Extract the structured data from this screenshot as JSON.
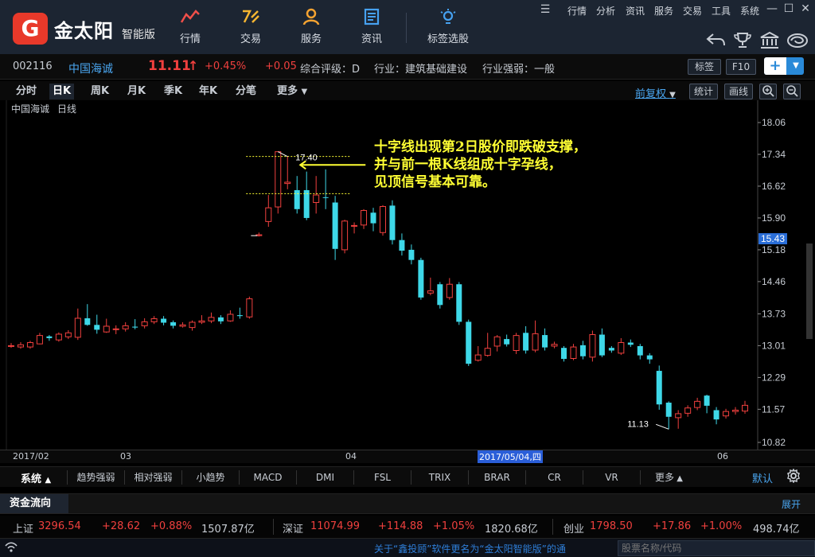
{
  "app": {
    "logo_char": "G",
    "brand": "金太阳",
    "brand_sub": "智能版"
  },
  "nav": [
    {
      "icon": "chart-line-icon",
      "glyph": "〽",
      "label": "行情",
      "color": "#f04f4a"
    },
    {
      "icon": "trade-icon",
      "glyph": "⚡",
      "label": "交易",
      "color": "#f5b531"
    },
    {
      "icon": "user-icon",
      "glyph": "👤",
      "label": "服务",
      "color": "#f5a331"
    },
    {
      "icon": "news-icon",
      "glyph": "☰",
      "label": "资讯",
      "color": "#46a1f0"
    },
    {
      "icon": "bulb-icon",
      "glyph": "💡",
      "label": "标签选股",
      "color": "#46a1f0"
    }
  ],
  "menu": [
    "行情",
    "分析",
    "资讯",
    "服务",
    "交易",
    "工具",
    "系统"
  ],
  "quote": {
    "code": "002116",
    "name": "中国海诚",
    "price": "11.11",
    "arrow": "↑",
    "pct": "+0.45%",
    "chg": "+0.05",
    "rating": "综合评级：D",
    "industry": "行业：建筑基础建设",
    "strength": "行业强弱：一般",
    "tag_btn": "标签",
    "f10_btn": "F10"
  },
  "periods": [
    "分时",
    "日K",
    "周K",
    "月K",
    "季K",
    "年K",
    "分笔",
    "更多"
  ],
  "active_period": "日K",
  "right_tools": {
    "adjust": "前复权",
    "stat": "统计",
    "draw": "画线"
  },
  "chart_title": {
    "name": "中国海诚",
    "period": "日线"
  },
  "annotation": {
    "line1": "十字线出现第2日股价即跌破支撑，",
    "line2": "并与前一根K线组成十字孕线，",
    "line3": "见顶信号基本可靠。",
    "high_label": "17.40",
    "low_label": "11.13",
    "color": "#ffff33"
  },
  "chart_data": {
    "type": "candlestick",
    "y_ticks": [
      18.06,
      17.34,
      16.62,
      15.9,
      15.18,
      14.46,
      13.73,
      13.01,
      12.29,
      11.57,
      10.82
    ],
    "current_price_label": "15.43",
    "ylim": [
      10.82,
      18.06
    ],
    "colors": {
      "up": "#f0403e",
      "down": "#3ed8e8"
    },
    "x_labels": [
      "2017/02",
      "03",
      "04",
      "2017/05/04,四",
      "06"
    ],
    "candles": [
      [
        13.01,
        13.01,
        13.07,
        12.96
      ],
      [
        12.98,
        13.03,
        13.09,
        12.94
      ],
      [
        12.98,
        13.08,
        13.12,
        12.94
      ],
      [
        13.05,
        13.24,
        13.3,
        13.04
      ],
      [
        13.22,
        13.18,
        13.25,
        13.12
      ],
      [
        13.14,
        13.27,
        13.31,
        13.1
      ],
      [
        13.21,
        13.3,
        13.36,
        13.16
      ],
      [
        13.2,
        13.63,
        13.85,
        13.14
      ],
      [
        13.63,
        13.48,
        13.95,
        13.46
      ],
      [
        13.48,
        13.37,
        13.71,
        13.28
      ],
      [
        13.32,
        13.45,
        13.62,
        13.3
      ],
      [
        13.38,
        13.39,
        13.47,
        13.27
      ],
      [
        13.39,
        13.46,
        13.54,
        13.33
      ],
      [
        13.44,
        13.42,
        13.61,
        13.38
      ],
      [
        13.46,
        13.55,
        13.63,
        13.4
      ],
      [
        13.55,
        13.62,
        13.68,
        13.5
      ],
      [
        13.62,
        13.53,
        13.68,
        13.47
      ],
      [
        13.54,
        13.46,
        13.58,
        13.4
      ],
      [
        13.45,
        13.48,
        13.54,
        13.42
      ],
      [
        13.42,
        13.54,
        13.58,
        13.35
      ],
      [
        13.54,
        13.57,
        13.7,
        13.5
      ],
      [
        13.57,
        13.65,
        13.76,
        13.52
      ],
      [
        13.65,
        13.56,
        13.7,
        13.5
      ],
      [
        13.57,
        13.72,
        13.81,
        13.55
      ],
      [
        13.7,
        13.68,
        13.87,
        13.62
      ],
      [
        13.66,
        14.07,
        14.12,
        13.62
      ],
      [
        15.5,
        15.52,
        15.57,
        15.48
      ],
      [
        15.82,
        16.13,
        16.42,
        15.7
      ],
      [
        16.15,
        17.4,
        17.4,
        16.0
      ],
      [
        16.68,
        16.71,
        17.3,
        16.55
      ],
      [
        16.53,
        16.1,
        16.85,
        16.0
      ],
      [
        16.53,
        15.9,
        16.95,
        15.85
      ],
      [
        16.25,
        16.42,
        16.85,
        16.0
      ],
      [
        16.37,
        16.36,
        17.0,
        16.1
      ],
      [
        16.25,
        15.2,
        16.4,
        14.95
      ],
      [
        15.18,
        15.83,
        15.86,
        15.1
      ],
      [
        15.73,
        15.73,
        15.8,
        15.55
      ],
      [
        15.74,
        16.07,
        16.1,
        15.65
      ],
      [
        16.02,
        15.78,
        16.13,
        15.6
      ],
      [
        15.57,
        16.16,
        16.19,
        15.5
      ],
      [
        16.18,
        15.4,
        16.3,
        15.3
      ],
      [
        15.4,
        15.16,
        15.55,
        15.05
      ],
      [
        15.18,
        14.95,
        15.3,
        14.85
      ],
      [
        14.95,
        14.1,
        15.0,
        14.05
      ],
      [
        14.2,
        14.25,
        14.55,
        14.15
      ],
      [
        14.4,
        13.93,
        14.45,
        13.85
      ],
      [
        14.1,
        14.4,
        14.54,
        14.05
      ],
      [
        14.4,
        13.55,
        14.45,
        13.48
      ],
      [
        13.55,
        12.6,
        13.6,
        12.55
      ],
      [
        12.68,
        12.8,
        13.0,
        12.65
      ],
      [
        12.79,
        12.95,
        13.3,
        12.76
      ],
      [
        13.0,
        13.21,
        13.25,
        12.88
      ],
      [
        13.16,
        13.04,
        13.26,
        12.99
      ],
      [
        12.9,
        13.24,
        13.3,
        12.82
      ],
      [
        13.3,
        12.9,
        13.45,
        12.83
      ],
      [
        12.91,
        13.28,
        13.58,
        12.86
      ],
      [
        13.25,
        12.97,
        13.4,
        12.9
      ],
      [
        13.0,
        13.04,
        13.1,
        12.95
      ],
      [
        12.96,
        12.71,
        13.0,
        12.65
      ],
      [
        12.72,
        12.98,
        13.05,
        12.68
      ],
      [
        13.02,
        12.77,
        13.12,
        12.7
      ],
      [
        12.75,
        13.26,
        13.35,
        12.65
      ],
      [
        13.26,
        12.79,
        13.4,
        12.75
      ],
      [
        12.96,
        12.9,
        13.0,
        12.85
      ],
      [
        12.84,
        13.08,
        13.18,
        12.8
      ],
      [
        13.08,
        13.03,
        13.15,
        12.98
      ],
      [
        13.0,
        12.79,
        13.05,
        12.7
      ],
      [
        12.79,
        12.7,
        12.84,
        12.6
      ],
      [
        12.44,
        11.68,
        12.56,
        11.56
      ],
      [
        11.72,
        11.4,
        11.75,
        11.12
      ],
      [
        11.38,
        11.47,
        11.55,
        11.13
      ],
      [
        11.48,
        11.6,
        11.66,
        11.4
      ],
      [
        11.61,
        11.75,
        11.83,
        11.55
      ],
      [
        11.88,
        11.65,
        11.9,
        11.48
      ],
      [
        11.55,
        11.34,
        11.62,
        11.23
      ],
      [
        11.42,
        11.52,
        11.58,
        11.36
      ],
      [
        11.52,
        11.55,
        11.62,
        11.45
      ],
      [
        11.53,
        11.66,
        11.76,
        11.47
      ]
    ]
  },
  "date_bar": {
    "start": "2017/02",
    "m3": "03",
    "m4": "04",
    "cursor": "2017/05/04,四",
    "m6": "06"
  },
  "indicators": {
    "system": "系统",
    "items": [
      "趋势强弱",
      "相对强弱",
      "小趋势",
      "MACD",
      "DMI",
      "FSL",
      "TRIX",
      "BRAR",
      "CR",
      "VR",
      "更多"
    ],
    "default": "默认"
  },
  "flow": {
    "title": "资金流向",
    "expand": "展开"
  },
  "indices": [
    {
      "name": "上证",
      "value": "3296.54",
      "chg": "+28.62",
      "pct": "+0.88%",
      "amount": "1507.87亿"
    },
    {
      "name": "深证",
      "value": "11074.99",
      "chg": "+114.88",
      "pct": "+1.05%",
      "amount": "1820.68亿"
    },
    {
      "name": "创业",
      "value": "1798.50",
      "chg": "+17.86",
      "pct": "+1.00%",
      "amount": "498.74亿"
    }
  ],
  "status": {
    "ticker": "关于“鑫投顾”软件更名为“金太阳智能版”的通",
    "search_placeholder": "股票名称/代码"
  }
}
